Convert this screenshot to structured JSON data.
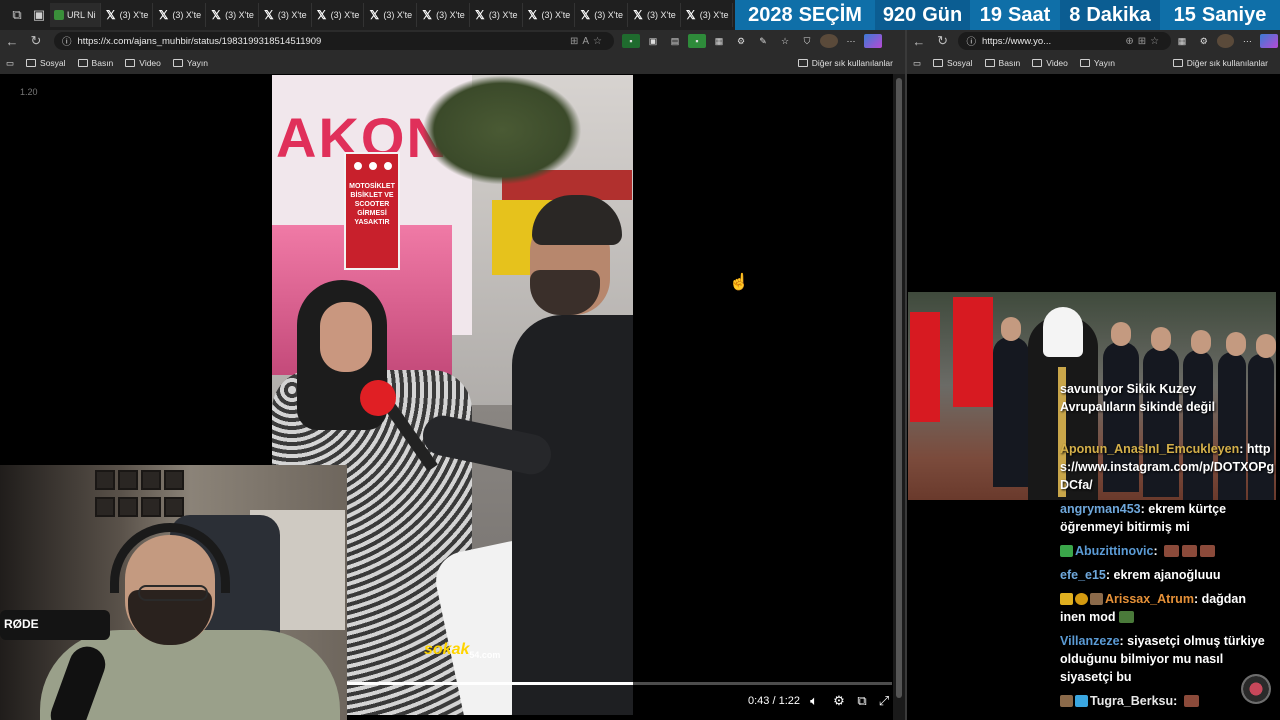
{
  "tabs": {
    "first_label": "URL Ni",
    "items": [
      "(3) X'te",
      "(3) X'te",
      "(3) X'te",
      "(3) X'te",
      "(3) X'te",
      "(3) X'te",
      "(3) X'te",
      "(3) X'te",
      "(3) X'te",
      "(3) X'te",
      "(3) X'te",
      "(3) X'te"
    ]
  },
  "countdown": {
    "year": "2028",
    "event": "SEÇİM",
    "days_value": "920",
    "days_label": "Gün",
    "hours_value": "19",
    "hours_label": "Saat",
    "minutes_value": "8",
    "minutes_label": "Dakika",
    "seconds_value": "15",
    "seconds_label": "Saniye"
  },
  "left_browser": {
    "url": "https://x.com/ajans_muhbir/status/1983199318514511909",
    "bookmarks": [
      "Sosyal",
      "Basın",
      "Video",
      "Yayın"
    ],
    "other_bookmarks": "Diğer sık kullanılanlar"
  },
  "video": {
    "corner_label": "1.20",
    "sign_text": "MOTOSİKLET BİSİKLET VE SCOOTER GİRMESİ YASAKTIR",
    "shop_text": "AKON",
    "logo_text": "sokak",
    "logo_sub": "54.com",
    "current_time": "0:43",
    "duration": "1:22",
    "time_display": "0:43 / 1:22",
    "progress": 0.524
  },
  "webcam": {
    "mic_brand": "RØDE"
  },
  "right_browser": {
    "url": "https://www.yo...",
    "bookmarks": [
      "Sosyal",
      "Basın",
      "Video",
      "Yayın"
    ],
    "other_bookmarks": "Diğer sık kullanılanlar"
  },
  "chat": {
    "overlay_lines": [
      "savunuyor Sikik Kuzey",
      "Avrupalıların sikinde değil"
    ],
    "messages": [
      {
        "user": "Aponun_AnasInI_Emcukleyen",
        "color": "#d4b04a",
        "text": "https://www.instagram.com/p/DOTXOPgDCfa/"
      },
      {
        "user": "angryman453",
        "color": "#6fa8dc",
        "text": "ekrem kürtçe öğrenmeyi bitirmiş mi"
      },
      {
        "user": "Abuzittinovic",
        "color": "#5b9bd5",
        "text": ""
      },
      {
        "user": "efe_e15",
        "color": "#6fa8dc",
        "text": "ekrem ajanoğluuu"
      },
      {
        "user": "Arissax_Atrum",
        "color": "#e69138",
        "text": "dağdan inen mod"
      },
      {
        "user": "Villanzeze",
        "color": "#5b9bd5",
        "text": "siyasetçi olmuş türkiye olduğunu bilmiyor mu nasıl siyasetçi bu"
      },
      {
        "user": "Tugra_Berksu",
        "color": "#e8e8e8",
        "text": ""
      }
    ]
  },
  "colors": {
    "countdown_bg": "#0f6fa8",
    "chat_user_gold": "#d4b04a",
    "chat_user_blue": "#6fa8dc"
  }
}
